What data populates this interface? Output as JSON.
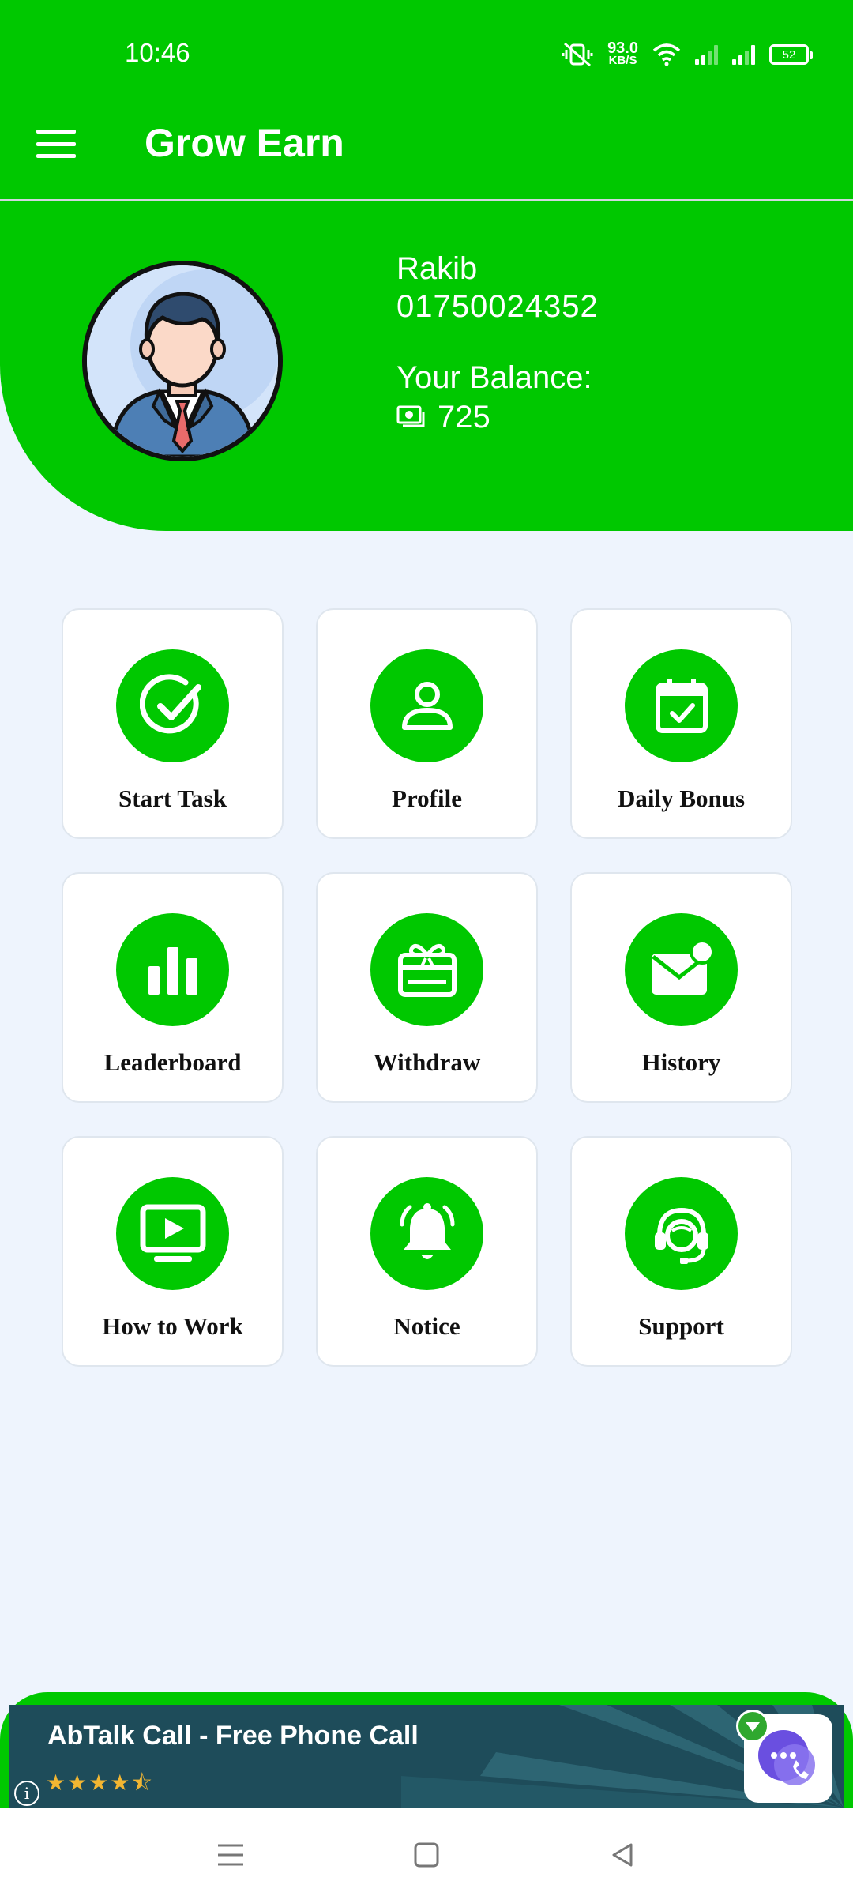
{
  "status_bar": {
    "time": "10:46",
    "net_speed_value": "93.0",
    "net_speed_unit": "KB/S",
    "battery": "52"
  },
  "app_bar": {
    "title": "Grow Earn",
    "menu_icon": "hamburger-menu-icon"
  },
  "profile": {
    "name": "Rakib",
    "phone": "01750024352",
    "balance_label": "Your Balance:",
    "balance_value": "725",
    "avatar_icon": "businessman-avatar"
  },
  "menu": [
    {
      "label": "Start Task",
      "icon": "check-circle-icon"
    },
    {
      "label": "Profile",
      "icon": "user-icon"
    },
    {
      "label": "Daily Bonus",
      "icon": "calendar-check-icon"
    },
    {
      "label": "Leaderboard",
      "icon": "bar-chart-icon"
    },
    {
      "label": "Withdraw",
      "icon": "gift-card-icon"
    },
    {
      "label": "History",
      "icon": "mail-notification-icon"
    },
    {
      "label": "How to Work",
      "icon": "video-play-icon"
    },
    {
      "label": "Notice",
      "icon": "bell-ringing-icon"
    },
    {
      "label": "Support",
      "icon": "headset-support-icon"
    }
  ],
  "ad": {
    "title": "AbTalk Call - Free Phone Call",
    "stars": "★★★★⯪",
    "info": "i"
  },
  "colors": {
    "brand_green": "#00c800",
    "background": "#eef4fd",
    "ad_background": "#1e4c5a"
  }
}
